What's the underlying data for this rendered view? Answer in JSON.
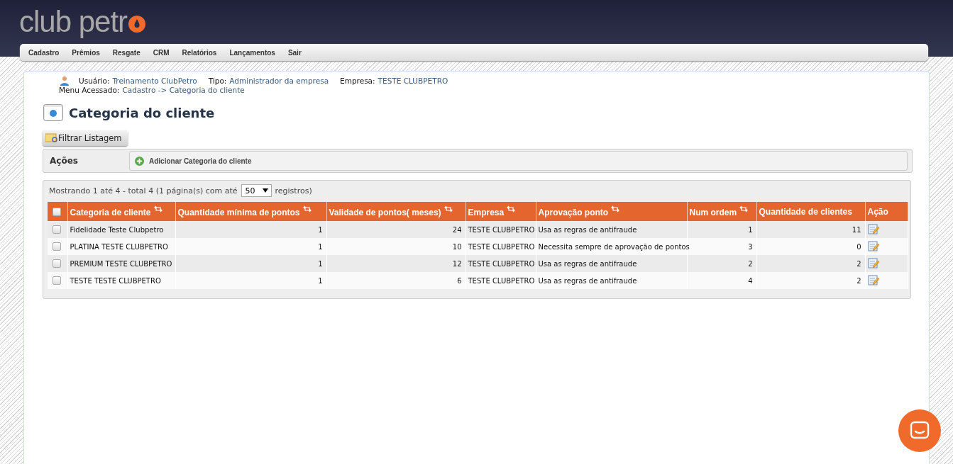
{
  "logo": {
    "text": "club petr"
  },
  "menu": [
    "Cadastro",
    "Prêmios",
    "Resgate",
    "CRM",
    "Relatórios",
    "Lançamentos",
    "Sair"
  ],
  "user_info": {
    "usuario_label": "Usuário:",
    "usuario": "Treinamento ClubPetro",
    "tipo_label": "Tipo:",
    "tipo": "Administrador da empresa",
    "empresa_label": "Empresa:",
    "empresa": "TESTE CLUBPETRO",
    "menu_label": "Menu Acessado:",
    "menu_path": "Cadastro -> Categoria do cliente"
  },
  "page_title": "Categoria do cliente",
  "filter_button": "Filtrar Listagem",
  "actions": {
    "label": "Ações",
    "add": "Adicionar Categoria do cliente"
  },
  "listing": {
    "showing": "Mostrando 1 até 4 - total 4 (1 página(s) com até",
    "page_size": "50",
    "suffix": "registros)"
  },
  "table": {
    "select_all_checked": false,
    "columns": [
      {
        "label": "Categoria de cliente",
        "sortable": true,
        "kind": "text"
      },
      {
        "label": "Quantidade mínima de pontos",
        "sortable": true,
        "kind": "number"
      },
      {
        "label": "Validade de pontos( meses)",
        "sortable": true,
        "kind": "number"
      },
      {
        "label": "Empresa",
        "sortable": true,
        "kind": "text"
      },
      {
        "label": "Aprovação ponto",
        "sortable": true,
        "kind": "text"
      },
      {
        "label": "Num ordem",
        "sortable": true,
        "kind": "number"
      },
      {
        "label": "Quantidade de clientes",
        "sortable": false,
        "kind": "number"
      },
      {
        "label": "Ação",
        "sortable": false,
        "kind": "action"
      }
    ],
    "rows": [
      {
        "checked": false,
        "cells": [
          "Fidelidade Teste Clubpetro",
          "1",
          "24",
          "TESTE CLUBPETRO",
          "Usa as regras de antifraude",
          "1",
          "11"
        ]
      },
      {
        "checked": false,
        "cells": [
          "PLATINA TESTE CLUBPETRO",
          "1",
          "10",
          "TESTE CLUBPETRO",
          "Necessita sempre de aprovação de pontos",
          "3",
          "0"
        ]
      },
      {
        "checked": false,
        "cells": [
          "PREMIUM TESTE CLUBPETRO",
          "1",
          "12",
          "TESTE CLUBPETRO",
          "Usa as regras de antifraude",
          "2",
          "2"
        ]
      },
      {
        "checked": false,
        "cells": [
          "TESTE TESTE CLUBPETRO",
          "1",
          "6",
          "TESTE CLUBPETRO",
          "Usa as regras de antifraude",
          "4",
          "2"
        ]
      }
    ]
  }
}
